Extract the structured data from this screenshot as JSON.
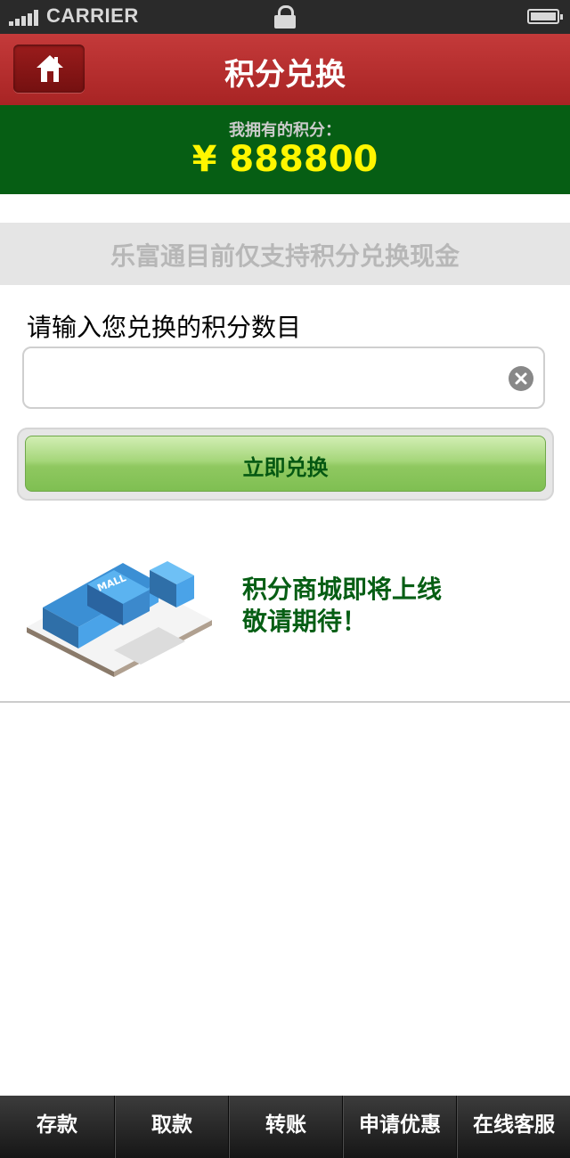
{
  "status_bar": {
    "carrier": "CARRIER",
    "icons": [
      "signal-icon",
      "lock-icon",
      "battery-icon"
    ]
  },
  "header": {
    "title": "积分兑换",
    "home_icon": "home-icon",
    "background": "#b02c2c"
  },
  "points": {
    "label": "我拥有的积分：",
    "value": "¥ 888800",
    "background": "#065e14",
    "label_color": "#cccccc",
    "value_color": "#fff600"
  },
  "notice": {
    "text": "乐富通目前仅支持积分兑换现金",
    "background": "#e5e5e5",
    "color": "#b7b7b7"
  },
  "exchange_form": {
    "prompt": "请输入您兑换的积分数目",
    "input_value": "",
    "input_placeholder": "",
    "clear_icon": "clear-icon",
    "submit_label": "立即兑换",
    "submit_color": "#055812"
  },
  "promo": {
    "image": "mall-building-illustration",
    "line1": "积分商城即将上线",
    "line2": "敬请期待！",
    "color": "#065e14"
  },
  "tabbar": {
    "tabs": [
      {
        "label": "存款"
      },
      {
        "label": "取款"
      },
      {
        "label": "转账"
      },
      {
        "label": "申请优惠"
      },
      {
        "label": "在线客服"
      }
    ]
  }
}
